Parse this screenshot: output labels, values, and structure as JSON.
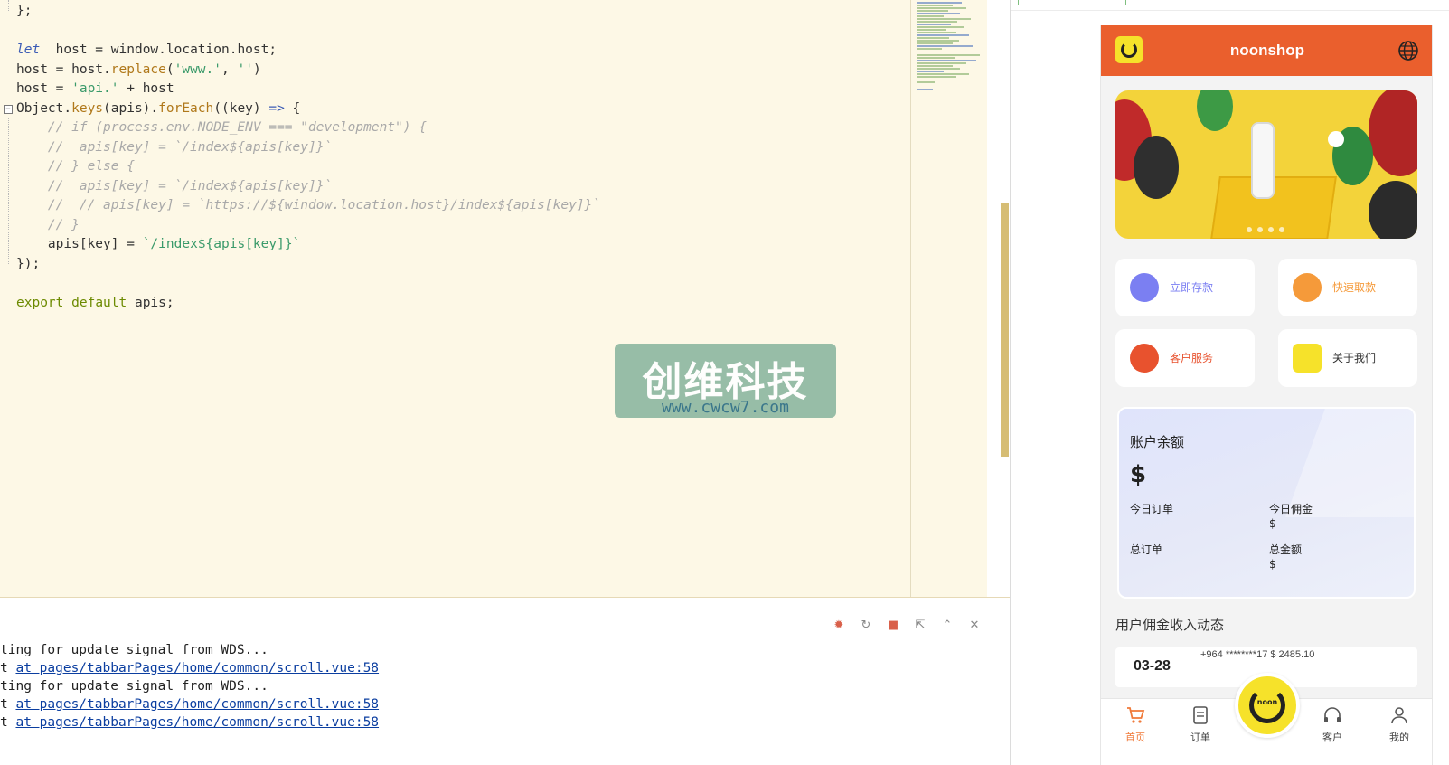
{
  "editor": {
    "lines": [
      {
        "text": "};"
      },
      {
        "text": ""
      },
      {
        "parts": [
          [
            "kw-i",
            "let"
          ],
          [
            "",
            "  host = window.location.host;"
          ]
        ]
      },
      {
        "text": "host = host.replace('www.', '')"
      },
      {
        "text": "host = 'api.' + host"
      },
      {
        "text": "Object.keys(apis).forEach((key) => {"
      },
      {
        "text": "    // if (process.env.NODE_ENV === \"development\") {"
      },
      {
        "text": "    //  apis[key] = `/index${apis[key]}`"
      },
      {
        "text": "    // } else {"
      },
      {
        "text": "    //  apis[key] = `/index${apis[key]}`"
      },
      {
        "text": "    //  // apis[key] = `https://${window.location.host}/index${apis[key]}`"
      },
      {
        "text": "    // }"
      },
      {
        "text": "    apis[key] = `/index${apis[key]}`"
      },
      {
        "text": "});"
      },
      {
        "text": ""
      },
      {
        "text": "export default apis;"
      }
    ],
    "fold_marker": "−"
  },
  "watermark": {
    "title": "创维科技",
    "url": "www.cwcw7.com"
  },
  "console": {
    "toolbar_icons": [
      "bug-icon",
      "restart-icon",
      "stop-icon",
      "export-icon",
      "chevron-up-icon",
      "clear-icon"
    ],
    "lines": [
      {
        "prefix": "ting for update signal from WDS...",
        "link": ""
      },
      {
        "prefix": "t ",
        "link": "at pages/tabbarPages/home/common/scroll.vue:58"
      },
      {
        "prefix": "ting for update signal from WDS...",
        "link": ""
      },
      {
        "prefix": "t ",
        "link": "at pages/tabbarPages/home/common/scroll.vue:58"
      },
      {
        "prefix": "t ",
        "link": "at pages/tabbarPages/home/common/scroll.vue:58"
      }
    ]
  },
  "app": {
    "title": "noonshop",
    "header_color": "#ea5f2d",
    "accent_color": "#f6e22a",
    "tiles": [
      {
        "label": "立即存款",
        "icon": "piggy-bank-icon",
        "color": "#7b7ff2"
      },
      {
        "label": "快速取款",
        "icon": "money-bag-icon",
        "color": "#f59a3a"
      },
      {
        "label": "客户服务",
        "icon": "headset-icon",
        "color": "#e8522e"
      },
      {
        "label": "关于我们",
        "icon": "noon-logo-icon",
        "color": "#333333"
      }
    ],
    "balance": {
      "title": "账户余额",
      "amount": "$",
      "today_orders_label": "今日订单",
      "today_commission_label": "今日佣金",
      "today_commission_value": "$",
      "total_orders_label": "总订单",
      "total_amount_label": "总金额",
      "total_amount_value": "$"
    },
    "feed": {
      "title": "用户佣金收入动态",
      "date": "03-28",
      "text": "+964 ********17 $ 2485.10"
    },
    "tabs": [
      {
        "label": "首页",
        "icon": "cart-icon",
        "active": true
      },
      {
        "label": "订单",
        "icon": "order-icon",
        "active": false
      },
      {
        "label": "客户",
        "icon": "headphones-icon",
        "active": false
      },
      {
        "label": "我的",
        "icon": "user-icon",
        "active": false
      }
    ],
    "center_button_text": "noon"
  }
}
